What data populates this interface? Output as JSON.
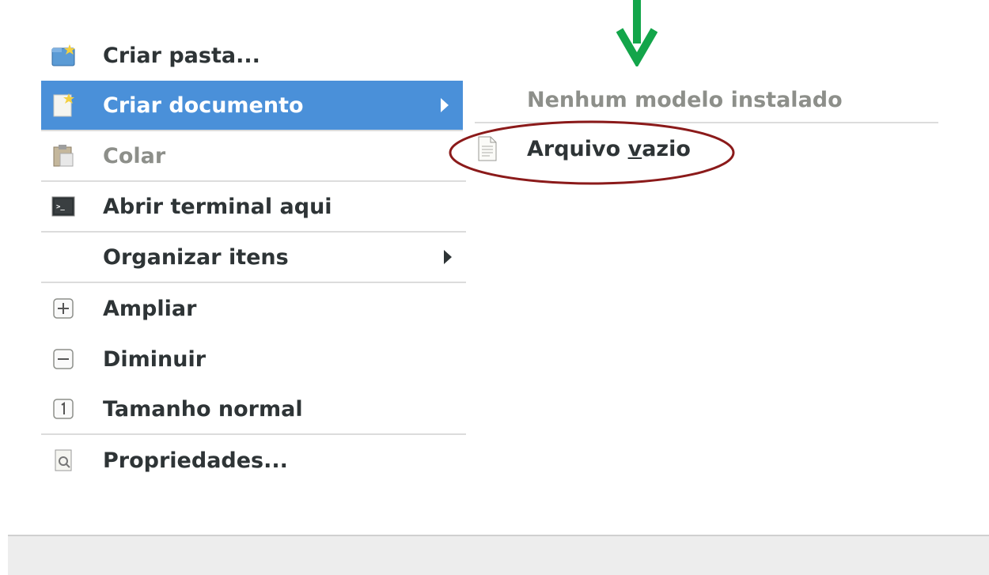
{
  "menu": {
    "items": [
      {
        "label": "Criar pasta...",
        "icon": "folder-new-icon"
      },
      {
        "label": "Criar documento",
        "icon": "document-new-icon",
        "active": true,
        "submenu": true
      },
      {
        "label": "Colar",
        "icon": "paste-icon",
        "disabled": true
      },
      {
        "label": "Abrir terminal aqui",
        "icon": "terminal-icon"
      },
      {
        "label": "Organizar itens",
        "submenu": true
      },
      {
        "label": "Ampliar",
        "icon": "zoom-in-icon"
      },
      {
        "label": "Diminuir",
        "icon": "zoom-out-icon"
      },
      {
        "label": "Tamanho normal",
        "icon": "zoom-reset-icon"
      },
      {
        "label": "Propriedades...",
        "icon": "properties-icon"
      }
    ]
  },
  "submenu": {
    "header": "Nenhum modelo instalado",
    "item_prefix": "Arquivo ",
    "item_mnemonic": "v",
    "item_suffix": "azio",
    "item_icon": "text-document-icon"
  },
  "colors": {
    "highlight": "#4a90d9",
    "annotation_circle": "#8b1a1a",
    "annotation_arrow": "#13a54a"
  }
}
